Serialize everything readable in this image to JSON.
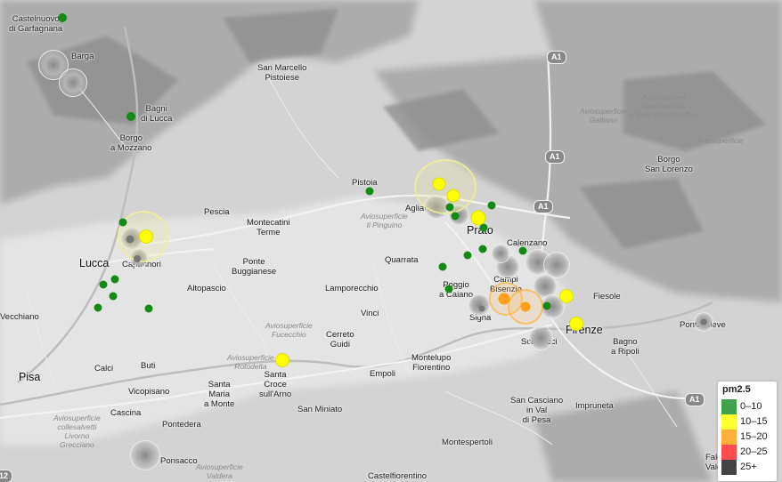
{
  "places": {
    "castelnuovo": "Castelnuovo\ndi Garfagnana",
    "barga": "Barga",
    "san_marcello": "San Marcello\nPistoiese",
    "bagni_di_lucca": "Bagni\ndi Lucca",
    "borgo_a_mozzano": "Borgo\na Mozzano",
    "pescia": "Pescia",
    "montecatini": "Montecatini\nTerme",
    "pistoia": "Pistoia",
    "agliana": "Agliana",
    "prato": "Prato",
    "calenzano": "Calenzano",
    "lucca": "Lucca",
    "capannori": "Capannori",
    "ponte_buggianese": "Ponte\nBuggianese",
    "altopascio": "Altopascio",
    "quarrata": "Quarrata",
    "poggio_a_caiano": "Poggio\na Caiano",
    "lamporecchio": "Lamporecchio",
    "campi_bisenzio": "Campi\nBisenzio",
    "signa": "Signa",
    "fiesole": "Fiesole",
    "firenze": "Firenze",
    "vinci": "Vinci",
    "cerreto_guidi": "Cerreto\nGuidi",
    "vecchiano": "Vecchiano",
    "calci": "Calci",
    "buti": "Buti",
    "pisa": "Pisa",
    "vicopisano": "Vicopisano",
    "santa_maria": "Santa\nMaria\na Monte",
    "santa_croce": "Santa\nCroce\nsull'Arno",
    "empoli": "Empoli",
    "montelupo": "Montelupo\nFiorentino",
    "scandicci": "Scandicci",
    "bagno_a_ripoli": "Bagno\na Ripoli",
    "pontassieve": "Pontassieve",
    "borgo_san_lorenzo": "Borgo\nSan Lorenzo",
    "cascina": "Cascina",
    "pontedera": "Pontedera",
    "san_miniato": "San Miniato",
    "san_casciano": "San Casciano\nin Val\ndi Pesa",
    "impruneta": "Impruneta",
    "montespertoli": "Montespertoli",
    "ponsacco": "Ponsacco",
    "castelfiorentino": "Castelfiorentino",
    "vald": "Vald",
    "falc": "Falc"
  },
  "airfields": {
    "prato": "Aviosuperficie\nIl Pinguino",
    "galliano": "Aviosuperficie\nGalliano",
    "associazione": "Associazione\nsportiva Volo\nA Vela Aviosuperficie",
    "fucecchio": "Aviosuperficie\nFucecchio",
    "rotodelta": "Aviosuperficie\nRotodelta",
    "pisa": "Aviosuperficie\ncollesalvetti\nLivorno\nGrecciano",
    "valdera": "Aviosuperficie\nValdera",
    "ne": "Aviosuperficie"
  },
  "highways": {
    "a1_north": "A1",
    "a1_mid": "A1",
    "a1_south": "A1",
    "a1_east": "A1",
    "a12": "12"
  },
  "legend": {
    "title": "pm2.5",
    "items": [
      {
        "label": "0–10",
        "color": "#3fa34d"
      },
      {
        "label": "10–15",
        "color": "#ffff33"
      },
      {
        "label": "15–20",
        "color": "#ffb03b"
      },
      {
        "label": "20–25",
        "color": "#ff4d4d"
      },
      {
        "label": "25+",
        "color": "#444444"
      }
    ]
  },
  "sensor_colors": {
    "green": "#138b13",
    "yellow": "#ffff00",
    "orange": "#ff9f1a",
    "gray": "#777777"
  },
  "sensor_counts": {
    "green": 22,
    "yellow": 8,
    "orange": 2,
    "gray": 23
  }
}
